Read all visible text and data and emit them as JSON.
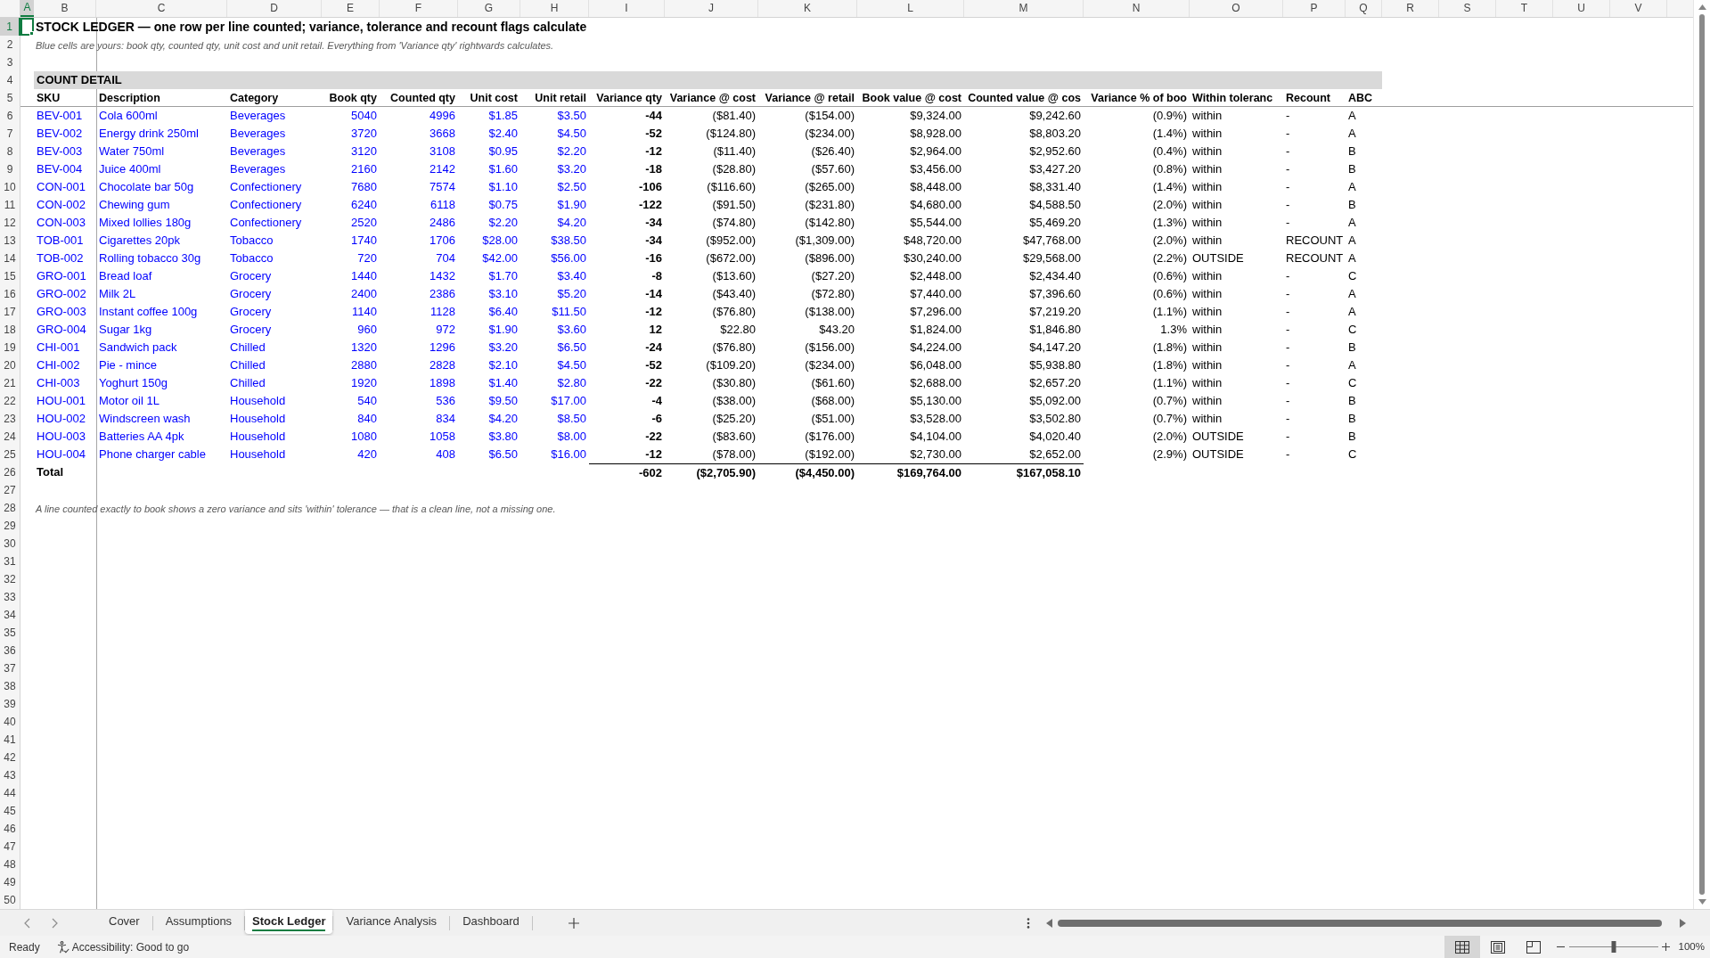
{
  "column_headers": [
    {
      "label": "A",
      "selected": true
    },
    {
      "label": "B",
      "selected": false
    },
    {
      "label": "C",
      "selected": false
    },
    {
      "label": "D",
      "selected": false
    },
    {
      "label": "E",
      "selected": false
    },
    {
      "label": "F",
      "selected": false
    },
    {
      "label": "G",
      "selected": false
    },
    {
      "label": "H",
      "selected": false
    },
    {
      "label": "I",
      "selected": false
    },
    {
      "label": "J",
      "selected": false
    },
    {
      "label": "K",
      "selected": false
    },
    {
      "label": "L",
      "selected": false
    },
    {
      "label": "M",
      "selected": false
    },
    {
      "label": "N",
      "selected": false
    },
    {
      "label": "O",
      "selected": false
    },
    {
      "label": "P",
      "selected": false
    },
    {
      "label": "Q",
      "selected": false
    },
    {
      "label": "R",
      "selected": false
    },
    {
      "label": "S",
      "selected": false
    },
    {
      "label": "T",
      "selected": false
    },
    {
      "label": "U",
      "selected": false
    },
    {
      "label": "V",
      "selected": false
    }
  ],
  "row_headers": [
    {
      "label": "1",
      "selected": true
    },
    {
      "label": "2",
      "selected": false
    },
    {
      "label": "3",
      "selected": false
    },
    {
      "label": "4",
      "selected": false
    },
    {
      "label": "5",
      "selected": false
    },
    {
      "label": "6",
      "selected": false
    },
    {
      "label": "7",
      "selected": false
    },
    {
      "label": "8",
      "selected": false
    },
    {
      "label": "9",
      "selected": false
    },
    {
      "label": "10",
      "selected": false
    },
    {
      "label": "11",
      "selected": false
    },
    {
      "label": "12",
      "selected": false
    },
    {
      "label": "13",
      "selected": false
    },
    {
      "label": "14",
      "selected": false
    },
    {
      "label": "15",
      "selected": false
    },
    {
      "label": "16",
      "selected": false
    },
    {
      "label": "17",
      "selected": false
    },
    {
      "label": "18",
      "selected": false
    },
    {
      "label": "19",
      "selected": false
    },
    {
      "label": "20",
      "selected": false
    },
    {
      "label": "21",
      "selected": false
    },
    {
      "label": "22",
      "selected": false
    },
    {
      "label": "23",
      "selected": false
    },
    {
      "label": "24",
      "selected": false
    },
    {
      "label": "25",
      "selected": false
    },
    {
      "label": "26",
      "selected": false
    },
    {
      "label": "27",
      "selected": false
    },
    {
      "label": "28",
      "selected": false
    },
    {
      "label": "29",
      "selected": false
    },
    {
      "label": "30",
      "selected": false
    },
    {
      "label": "31",
      "selected": false
    },
    {
      "label": "32",
      "selected": false
    },
    {
      "label": "33",
      "selected": false
    },
    {
      "label": "34",
      "selected": false
    },
    {
      "label": "35",
      "selected": false
    },
    {
      "label": "36",
      "selected": false
    },
    {
      "label": "37",
      "selected": false
    },
    {
      "label": "38",
      "selected": false
    },
    {
      "label": "39",
      "selected": false
    },
    {
      "label": "40",
      "selected": false
    },
    {
      "label": "41",
      "selected": false
    },
    {
      "label": "42",
      "selected": false
    },
    {
      "label": "43",
      "selected": false
    },
    {
      "label": "44",
      "selected": false
    },
    {
      "label": "45",
      "selected": false
    },
    {
      "label": "46",
      "selected": false
    },
    {
      "label": "47",
      "selected": false
    },
    {
      "label": "48",
      "selected": false
    },
    {
      "label": "49",
      "selected": false
    },
    {
      "label": "50",
      "selected": false
    }
  ],
  "sheet": {
    "title": "STOCK LEDGER — one row per line counted; variance, tolerance and recount flags calculate",
    "subtitle": "Blue cells are yours: book qty, counted qty, unit cost and unit retail. Everything from 'Variance qty' rightwards calculates.",
    "section_heading": "COUNT DETAIL",
    "table": {
      "columns": [
        {
          "label": "SKU",
          "kind": "label"
        },
        {
          "label": "Description",
          "kind": "label"
        },
        {
          "label": "Category",
          "kind": "label"
        },
        {
          "label": "Book qty",
          "kind": "input"
        },
        {
          "label": "Counted qty",
          "kind": "input"
        },
        {
          "label": "Unit cost",
          "kind": "input"
        },
        {
          "label": "Unit retail",
          "kind": "input"
        },
        {
          "label": "Variance qty",
          "kind": "key"
        },
        {
          "label": "Variance @ cost",
          "kind": "amount"
        },
        {
          "label": "Variance @ retail",
          "kind": "amount"
        },
        {
          "label": "Book value @ cost",
          "kind": "amount"
        },
        {
          "label": "Counted value @ cos",
          "kind": "amount"
        },
        {
          "label": "Variance % of boo",
          "kind": "amount"
        },
        {
          "label": "Within toleranc",
          "kind": "flag"
        },
        {
          "label": "Recount",
          "kind": "flag"
        },
        {
          "label": "ABC",
          "kind": "flag"
        }
      ],
      "rows": [
        [
          "BEV-001",
          "Cola 600ml",
          "Beverages",
          "5040",
          "4996",
          "$1.85",
          "$3.50",
          "-44",
          "($81.40)",
          "($154.00)",
          "$9,324.00",
          "$9,242.60",
          "(0.9%)",
          "within",
          "-",
          "A"
        ],
        [
          "BEV-002",
          "Energy drink 250ml",
          "Beverages",
          "3720",
          "3668",
          "$2.40",
          "$4.50",
          "-52",
          "($124.80)",
          "($234.00)",
          "$8,928.00",
          "$8,803.20",
          "(1.4%)",
          "within",
          "-",
          "A"
        ],
        [
          "BEV-003",
          "Water 750ml",
          "Beverages",
          "3120",
          "3108",
          "$0.95",
          "$2.20",
          "-12",
          "($11.40)",
          "($26.40)",
          "$2,964.00",
          "$2,952.60",
          "(0.4%)",
          "within",
          "-",
          "B"
        ],
        [
          "BEV-004",
          "Juice 400ml",
          "Beverages",
          "2160",
          "2142",
          "$1.60",
          "$3.20",
          "-18",
          "($28.80)",
          "($57.60)",
          "$3,456.00",
          "$3,427.20",
          "(0.8%)",
          "within",
          "-",
          "B"
        ],
        [
          "CON-001",
          "Chocolate bar 50g",
          "Confectionery",
          "7680",
          "7574",
          "$1.10",
          "$2.50",
          "-106",
          "($116.60)",
          "($265.00)",
          "$8,448.00",
          "$8,331.40",
          "(1.4%)",
          "within",
          "-",
          "A"
        ],
        [
          "CON-002",
          "Chewing gum",
          "Confectionery",
          "6240",
          "6118",
          "$0.75",
          "$1.90",
          "-122",
          "($91.50)",
          "($231.80)",
          "$4,680.00",
          "$4,588.50",
          "(2.0%)",
          "within",
          "-",
          "B"
        ],
        [
          "CON-003",
          "Mixed lollies 180g",
          "Confectionery",
          "2520",
          "2486",
          "$2.20",
          "$4.20",
          "-34",
          "($74.80)",
          "($142.80)",
          "$5,544.00",
          "$5,469.20",
          "(1.3%)",
          "within",
          "-",
          "A"
        ],
        [
          "TOB-001",
          "Cigarettes 20pk",
          "Tobacco",
          "1740",
          "1706",
          "$28.00",
          "$38.50",
          "-34",
          "($952.00)",
          "($1,309.00)",
          "$48,720.00",
          "$47,768.00",
          "(2.0%)",
          "within",
          "RECOUNT",
          "A"
        ],
        [
          "TOB-002",
          "Rolling tobacco 30g",
          "Tobacco",
          "720",
          "704",
          "$42.00",
          "$56.00",
          "-16",
          "($672.00)",
          "($896.00)",
          "$30,240.00",
          "$29,568.00",
          "(2.2%)",
          "OUTSIDE",
          "RECOUNT",
          "A"
        ],
        [
          "GRO-001",
          "Bread loaf",
          "Grocery",
          "1440",
          "1432",
          "$1.70",
          "$3.40",
          "-8",
          "($13.60)",
          "($27.20)",
          "$2,448.00",
          "$2,434.40",
          "(0.6%)",
          "within",
          "-",
          "C"
        ],
        [
          "GRO-002",
          "Milk 2L",
          "Grocery",
          "2400",
          "2386",
          "$3.10",
          "$5.20",
          "-14",
          "($43.40)",
          "($72.80)",
          "$7,440.00",
          "$7,396.60",
          "(0.6%)",
          "within",
          "-",
          "A"
        ],
        [
          "GRO-003",
          "Instant coffee 100g",
          "Grocery",
          "1140",
          "1128",
          "$6.40",
          "$11.50",
          "-12",
          "($76.80)",
          "($138.00)",
          "$7,296.00",
          "$7,219.20",
          "(1.1%)",
          "within",
          "-",
          "A"
        ],
        [
          "GRO-004",
          "Sugar 1kg",
          "Grocery",
          "960",
          "972",
          "$1.90",
          "$3.60",
          "12",
          "$22.80",
          "$43.20",
          "$1,824.00",
          "$1,846.80",
          "1.3%",
          "within",
          "-",
          "C"
        ],
        [
          "CHI-001",
          "Sandwich pack",
          "Chilled",
          "1320",
          "1296",
          "$3.20",
          "$6.50",
          "-24",
          "($76.80)",
          "($156.00)",
          "$4,224.00",
          "$4,147.20",
          "(1.8%)",
          "within",
          "-",
          "B"
        ],
        [
          "CHI-002",
          "Pie - mince",
          "Chilled",
          "2880",
          "2828",
          "$2.10",
          "$4.50",
          "-52",
          "($109.20)",
          "($234.00)",
          "$6,048.00",
          "$5,938.80",
          "(1.8%)",
          "within",
          "-",
          "A"
        ],
        [
          "CHI-003",
          "Yoghurt 150g",
          "Chilled",
          "1920",
          "1898",
          "$1.40",
          "$2.80",
          "-22",
          "($30.80)",
          "($61.60)",
          "$2,688.00",
          "$2,657.20",
          "(1.1%)",
          "within",
          "-",
          "C"
        ],
        [
          "HOU-001",
          "Motor oil 1L",
          "Household",
          "540",
          "536",
          "$9.50",
          "$17.00",
          "-4",
          "($38.00)",
          "($68.00)",
          "$5,130.00",
          "$5,092.00",
          "(0.7%)",
          "within",
          "-",
          "B"
        ],
        [
          "HOU-002",
          "Windscreen wash",
          "Household",
          "840",
          "834",
          "$4.20",
          "$8.50",
          "-6",
          "($25.20)",
          "($51.00)",
          "$3,528.00",
          "$3,502.80",
          "(0.7%)",
          "within",
          "-",
          "B"
        ],
        [
          "HOU-003",
          "Batteries AA 4pk",
          "Household",
          "1080",
          "1058",
          "$3.80",
          "$8.00",
          "-22",
          "($83.60)",
          "($176.00)",
          "$4,104.00",
          "$4,020.40",
          "(2.0%)",
          "OUTSIDE",
          "-",
          "B"
        ],
        [
          "HOU-004",
          "Phone charger cable",
          "Household",
          "420",
          "408",
          "$6.50",
          "$16.00",
          "-12",
          "($78.00)",
          "($192.00)",
          "$2,730.00",
          "$2,652.00",
          "(2.9%)",
          "OUTSIDE",
          "-",
          "C"
        ]
      ],
      "total": {
        "label": "Total",
        "values": [
          "-602",
          "($2,705.90)",
          "($4,450.00)",
          "$169,764.00",
          "$167,058.10"
        ]
      }
    },
    "footnote": "A line counted exactly to book shows a zero variance and sits 'within' tolerance — that is a clean line, not a missing one."
  },
  "sheet_tabs": [
    {
      "label": "Cover",
      "selected": false
    },
    {
      "label": "Assumptions",
      "selected": false
    },
    {
      "label": "Stock Ledger",
      "selected": true
    },
    {
      "label": "Variance Analysis",
      "selected": false
    },
    {
      "label": "Dashboard",
      "selected": false
    }
  ],
  "status_bar": {
    "mode": "Ready",
    "accessibility": "Accessibility: Good to go",
    "view_buttons": [
      {
        "kind": "normal",
        "selected": true
      },
      {
        "kind": "layout",
        "selected": false
      },
      {
        "kind": "pagebreak",
        "selected": false
      }
    ],
    "zoom_slider": {
      "level": 0.5
    },
    "zoom": "100%"
  }
}
